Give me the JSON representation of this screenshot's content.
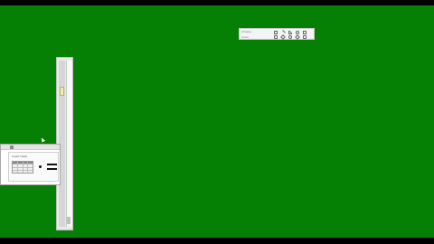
{
  "screen": {
    "background": "#058005",
    "letterbox": "#000000"
  },
  "toolbar": {
    "labels": [
      "Shapes",
      "Lines"
    ],
    "tools": [
      "rectangle-tool",
      "line-tool",
      "curve-tool",
      "ellipse-tool",
      "polygon-tool",
      "arrow-tool",
      "triangle-tool",
      "star-tool",
      "diamond-tool",
      "hexagon-tool"
    ]
  },
  "panel": {
    "slider_level_fraction": 0.18
  },
  "dialog": {
    "caption": "Insert table",
    "grid_rows": 4,
    "grid_cols": 4
  }
}
